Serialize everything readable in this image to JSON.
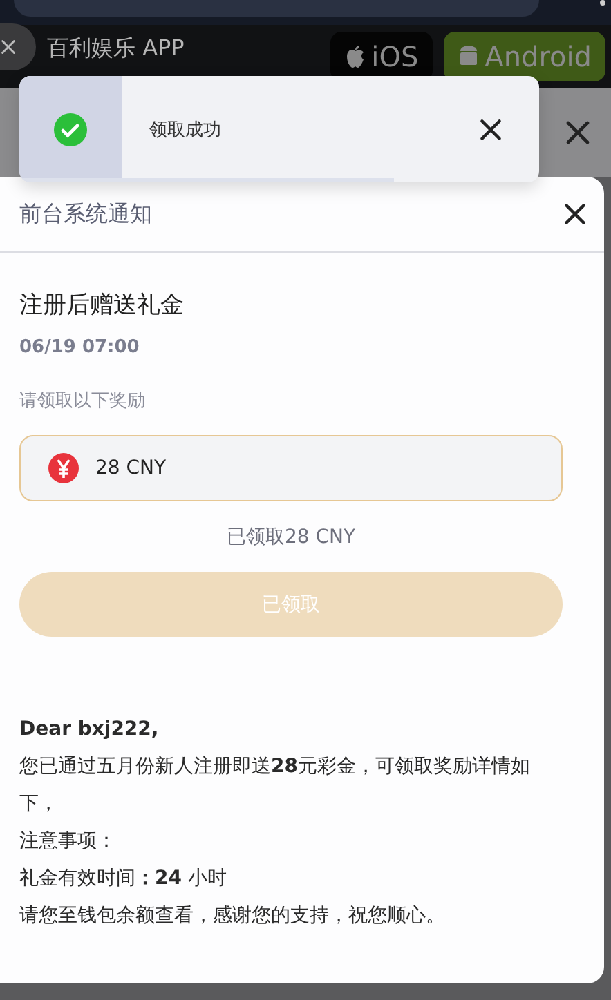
{
  "background": {
    "app_banner": {
      "title": "百利娱乐 APP",
      "buttons": [
        {
          "label": "iOS",
          "kind": "ios"
        },
        {
          "label": "Android",
          "kind": "android"
        }
      ]
    }
  },
  "toast": {
    "message": "领取成功",
    "level": 0.72
  },
  "modal": {
    "title": "前台系统通知",
    "notice_title": "注册后赠送礼金",
    "date": "06/19 07:00",
    "prompt": "请领取以下奖励",
    "reward": {
      "amount": "28 CNY"
    },
    "claimed_text": "已领取28 CNY",
    "claim_button": {
      "label": "已领取",
      "disabled": true
    },
    "message": [
      {
        "kind": "greeting",
        "text": "Dear bxj222,"
      },
      {
        "kind": "line",
        "text": "您已通过五月份新人注册即送**28**元彩金，可领取奖励详情如下，"
      },
      {
        "kind": "line",
        "text": "注意事项："
      },
      {
        "kind": "line",
        "text": "礼金有效时间**：24** 小时"
      },
      {
        "kind": "line",
        "text": "请您至钱包余额查看，感谢您的支持，祝您顺心。"
      }
    ]
  }
}
